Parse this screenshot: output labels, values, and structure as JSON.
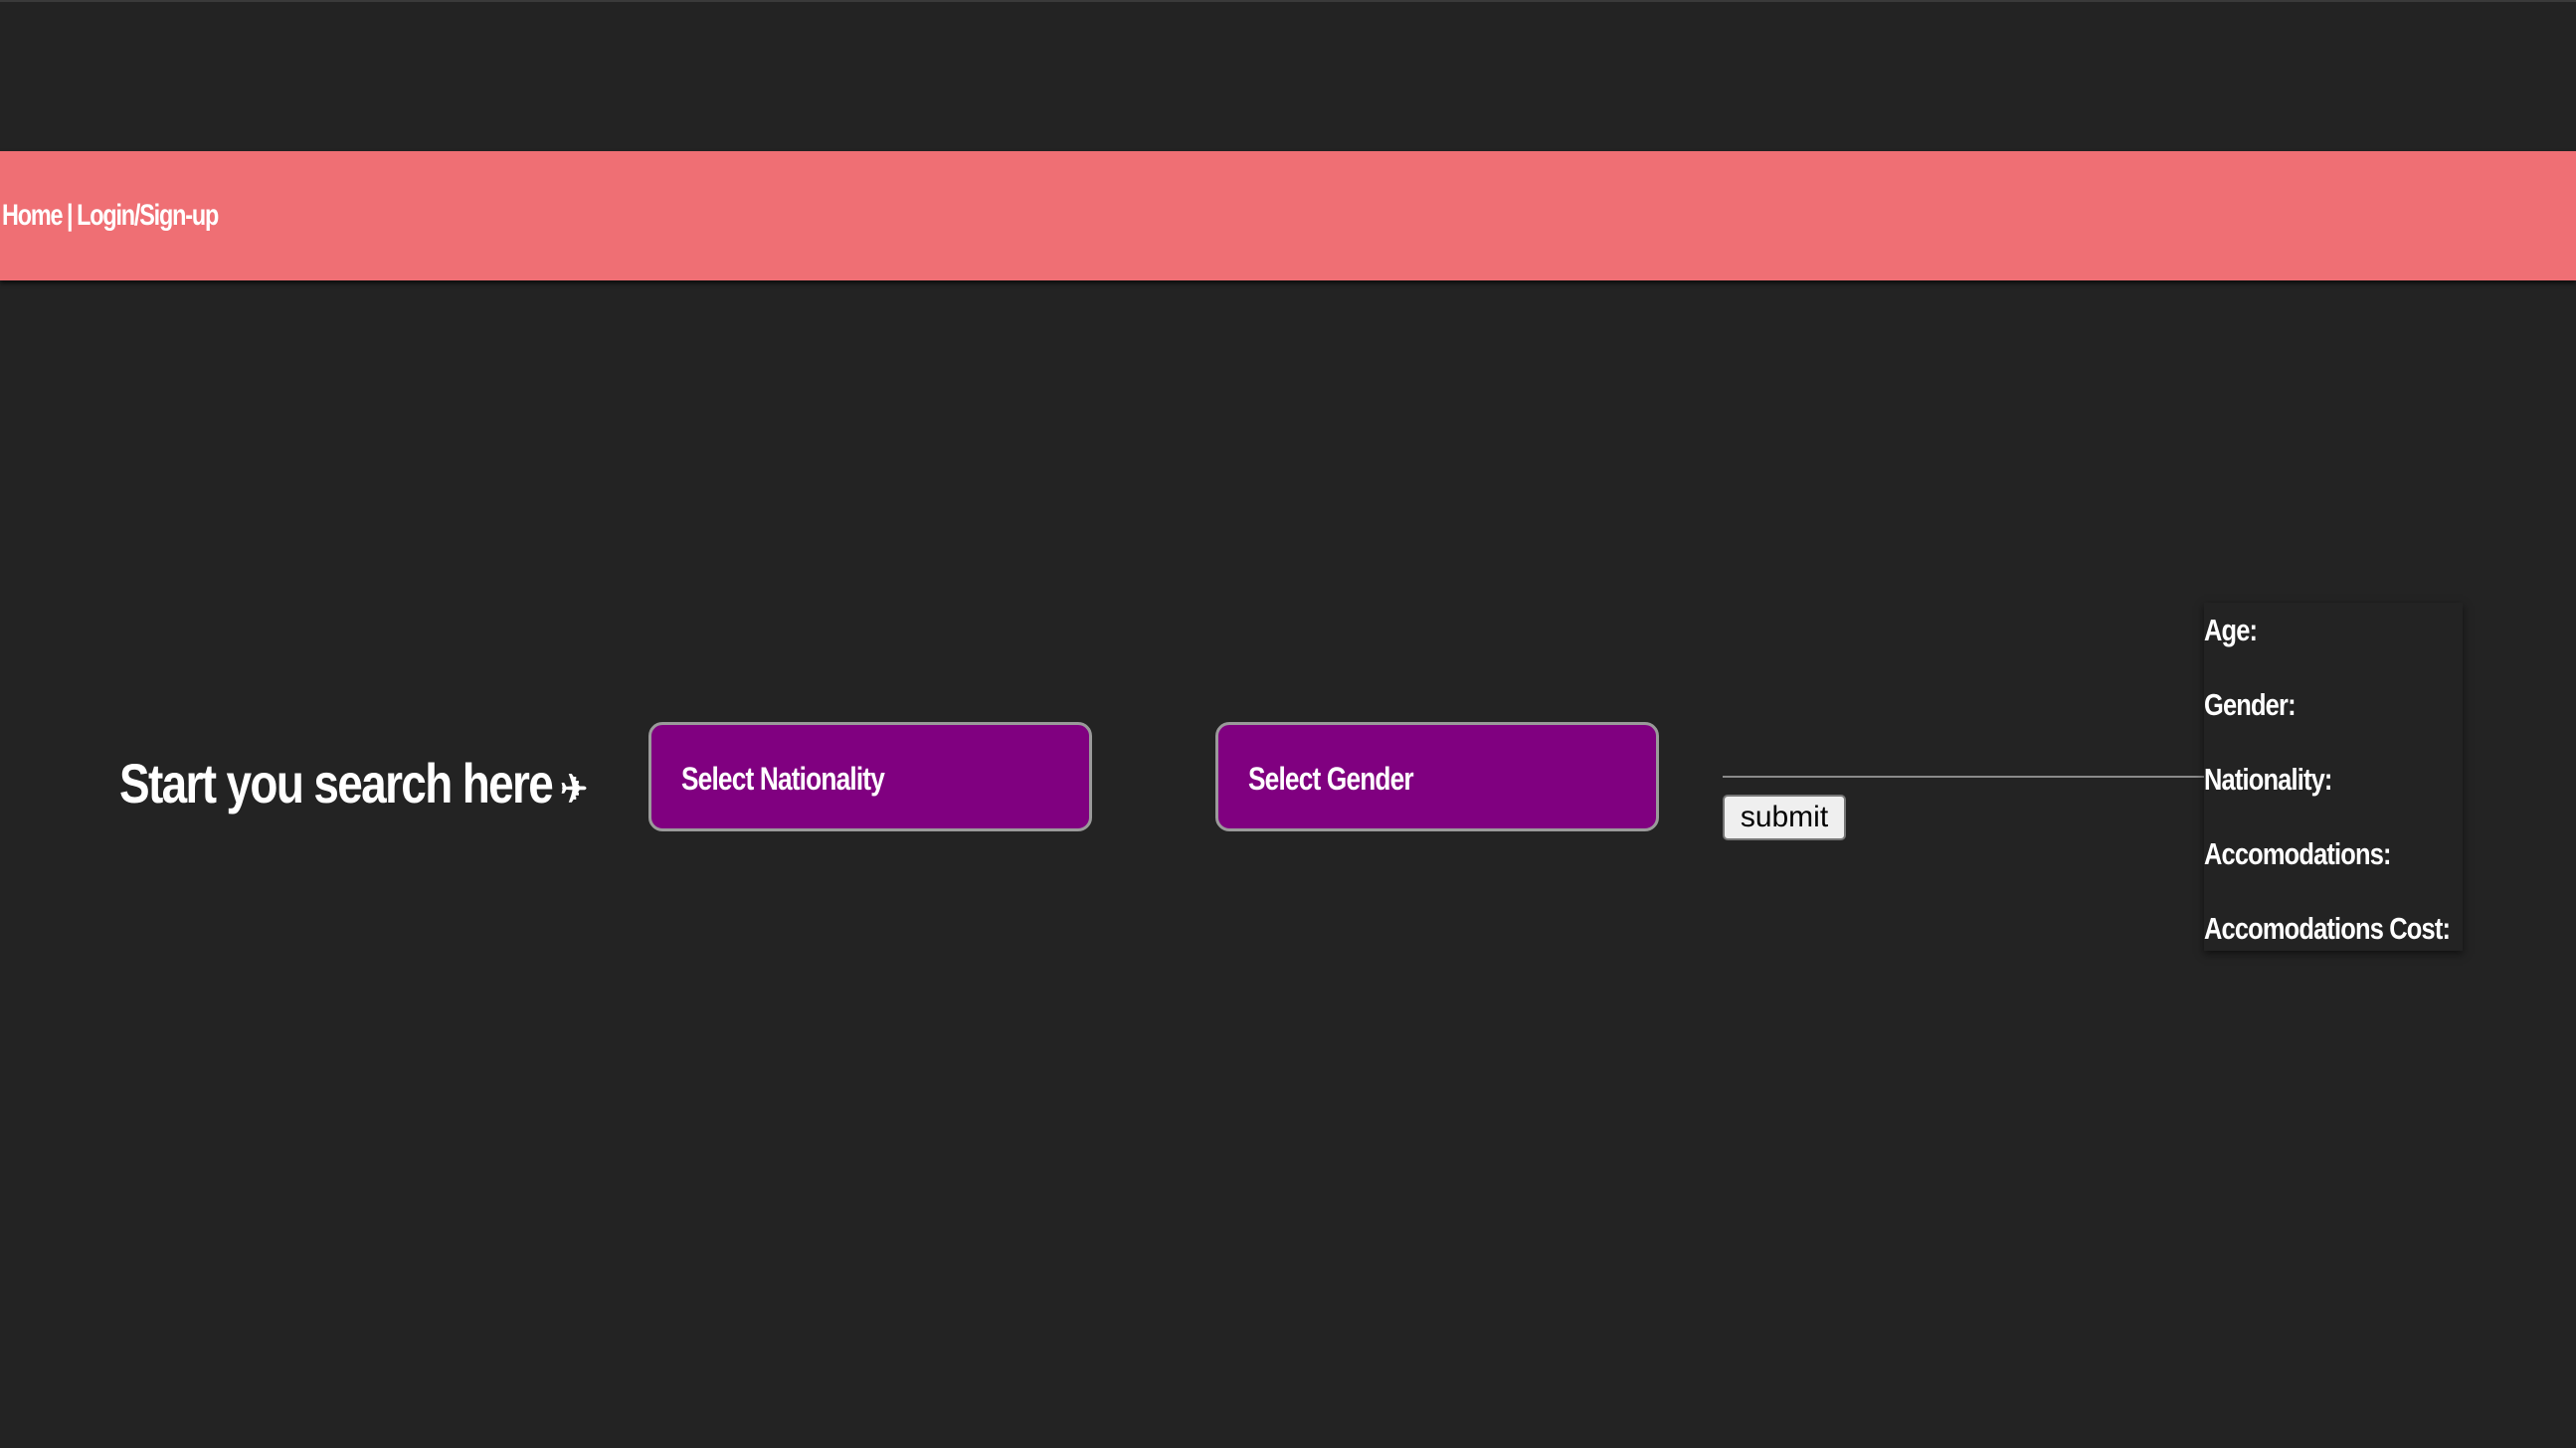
{
  "nav": {
    "home": "Home",
    "separator": "|",
    "login": "Login/Sign-up"
  },
  "headline": {
    "text": "Start you search here",
    "icon": "airplane-icon",
    "icon_glyph": "✈"
  },
  "selects": {
    "nationality": "Select Nationality",
    "gender": "Select Gender"
  },
  "submit_label": "submit",
  "info": {
    "age": "Age:",
    "gender": "Gender:",
    "nationality": "Nationality:",
    "accomodations": "Accomodations:",
    "accomodations_cost": "Accomodations Cost:"
  },
  "colors": {
    "background": "#232323",
    "header": "#ef6f74",
    "select_bg": "#800080"
  }
}
